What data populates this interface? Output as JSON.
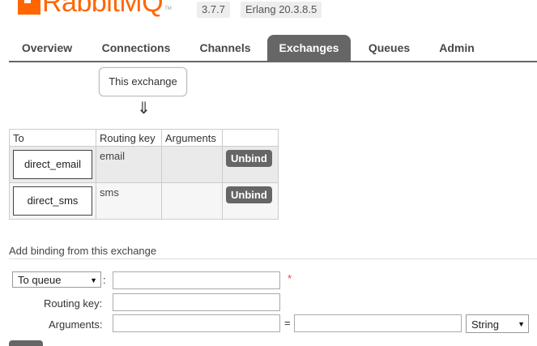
{
  "header": {
    "logo_text": "RabbitMQ",
    "trademark": "TM",
    "version": "3.7.7",
    "erlang": "Erlang 20.3.8.5"
  },
  "tabs": [
    {
      "label": "Overview",
      "active": false
    },
    {
      "label": "Connections",
      "active": false
    },
    {
      "label": "Channels",
      "active": false
    },
    {
      "label": "Exchanges",
      "active": true
    },
    {
      "label": "Queues",
      "active": false
    },
    {
      "label": "Admin",
      "active": false
    }
  ],
  "source": {
    "label": "This exchange",
    "arrow": "⇓"
  },
  "bindings": {
    "columns": [
      "To",
      "Routing key",
      "Arguments",
      ""
    ],
    "rows": [
      {
        "to": "direct_email",
        "routing_key": "email",
        "arguments": "",
        "action": "Unbind"
      },
      {
        "to": "direct_sms",
        "routing_key": "sms",
        "arguments": "",
        "action": "Unbind"
      }
    ]
  },
  "add_binding": {
    "title": "Add binding from this exchange",
    "dest_type": "To queue",
    "dest_value": "",
    "required_mark": "*",
    "routing_key_label": "Routing key:",
    "routing_key_value": "",
    "arguments_label": "Arguments:",
    "arg_key": "",
    "equals": "=",
    "arg_value": "",
    "arg_type": "String"
  },
  "colors": {
    "brand": "#ff6600",
    "tab_active": "#666666",
    "button": "#666666"
  }
}
